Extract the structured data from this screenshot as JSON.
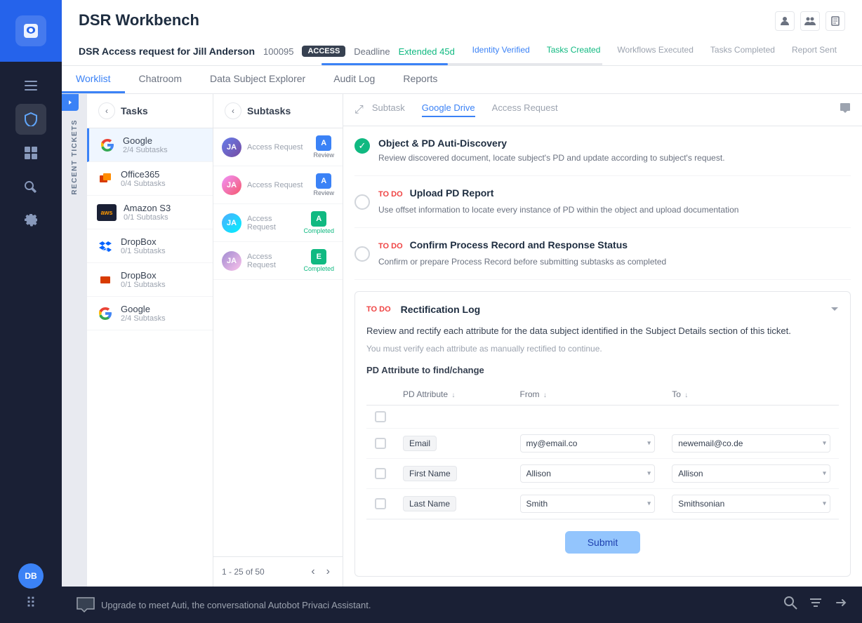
{
  "app": {
    "name": "securiti",
    "page_title": "DSR Workbench"
  },
  "sidebar": {
    "nav_items": [
      {
        "id": "menu",
        "icon": "☰",
        "label": "Menu"
      },
      {
        "id": "shield",
        "icon": "🛡",
        "label": "Security"
      },
      {
        "id": "dashboard",
        "icon": "⊞",
        "label": "Dashboard"
      },
      {
        "id": "tools",
        "icon": "🔧",
        "label": "Tools"
      },
      {
        "id": "settings",
        "icon": "⚙",
        "label": "Settings"
      }
    ],
    "user_initials": "DB",
    "dots_icon": "⠿"
  },
  "ticket": {
    "title": "DSR Access request for Jill Anderson",
    "id": "100095",
    "type": "ACCESS",
    "deadline_label": "Deadline",
    "deadline_status": "Extended",
    "deadline_days": "45d",
    "progress_steps": [
      {
        "label": "Identity Verified",
        "status": "active"
      },
      {
        "label": "Tasks Created",
        "status": "done"
      },
      {
        "label": "Workflows Executed",
        "status": "pending"
      },
      {
        "label": "Tasks Completed",
        "status": "pending"
      },
      {
        "label": "Report Sent",
        "status": "pending"
      }
    ],
    "action_icons": [
      "👤",
      "👥",
      "📄"
    ]
  },
  "main_tabs": [
    {
      "id": "worklist",
      "label": "Worklist",
      "active": true
    },
    {
      "id": "chatroom",
      "label": "Chatroom"
    },
    {
      "id": "data_subject",
      "label": "Data Subject Explorer"
    },
    {
      "id": "audit_log",
      "label": "Audit Log"
    },
    {
      "id": "reports",
      "label": "Reports"
    }
  ],
  "tasks": {
    "title": "Tasks",
    "items": [
      {
        "id": 1,
        "name": "Google",
        "subtasks": "2/4 Subtasks",
        "logo": "G",
        "active": true
      },
      {
        "id": 2,
        "name": "Office365",
        "subtasks": "0/4 Subtasks",
        "logo": "O"
      },
      {
        "id": 3,
        "name": "Amazon S3",
        "subtasks": "0/1 Subtasks",
        "logo": "aws"
      },
      {
        "id": 4,
        "name": "DropBox",
        "subtasks": "0/1 Subtasks",
        "logo": "D1"
      },
      {
        "id": 5,
        "name": "DropBox",
        "subtasks": "0/1 Subtasks",
        "logo": "D2"
      },
      {
        "id": 6,
        "name": "Google",
        "subtasks": "2/4 Subtasks",
        "logo": "G"
      }
    ]
  },
  "subtasks": {
    "title": "Subtasks",
    "items": [
      {
        "id": 1,
        "type": "Access Request",
        "badge": "A",
        "status": "Review",
        "badge_color": "blue"
      },
      {
        "id": 2,
        "type": "Access Request",
        "badge": "A",
        "status": "Review",
        "badge_color": "blue"
      },
      {
        "id": 3,
        "type": "Access Request",
        "badge": "A",
        "status": "Completed",
        "badge_color": "green"
      },
      {
        "id": 4,
        "type": "Access Request",
        "badge": "E",
        "status": "Completed",
        "badge_color": "green"
      }
    ],
    "pagination": "1 - 25 of 50"
  },
  "detail": {
    "tabs": [
      "Subtask",
      "Google Drive",
      "Access Request"
    ],
    "active_tab": "Google Drive",
    "tasks": [
      {
        "id": 1,
        "completed": true,
        "title": "Object & PD Auti-Discovery",
        "description": "Review discovered document, locate subject's PD and update according to subject's request."
      },
      {
        "id": 2,
        "completed": false,
        "todo": true,
        "title": "Upload PD Report",
        "description": "Use offset information to locate every instance of PD within the object and upload documentation"
      },
      {
        "id": 3,
        "completed": false,
        "todo": true,
        "title": "Confirm Process Record and Response Status",
        "description": "Confirm or prepare Process Record before submitting subtasks as completed"
      }
    ],
    "rectification": {
      "todo_label": "TO DO",
      "title": "Rectification Log",
      "description": "Review and rectify each attribute for the data subject identified in the Subject Details section of this ticket.",
      "note": "You must verify each attribute as manually rectified to continue.",
      "table_title": "PD Attribute to find/change",
      "columns": [
        "PD Attribute",
        "From",
        "To"
      ],
      "rows": [
        {
          "attribute": "Email",
          "from": "my@email.co",
          "to": "newemail@co.de"
        },
        {
          "attribute": "First Name",
          "from": "Allison",
          "to": "Allison"
        },
        {
          "attribute": "Last Name",
          "from": "Smith",
          "to": "Smithsonian"
        }
      ],
      "submit_label": "Submit"
    }
  },
  "bottom_bar": {
    "chat_placeholder": "Upgrade to meet Auti, the conversational Autobot Privaci Assistant.",
    "icons": [
      "search",
      "filter",
      "arrow-right"
    ]
  },
  "recent_tickets_label": "RECENT TICKETS"
}
